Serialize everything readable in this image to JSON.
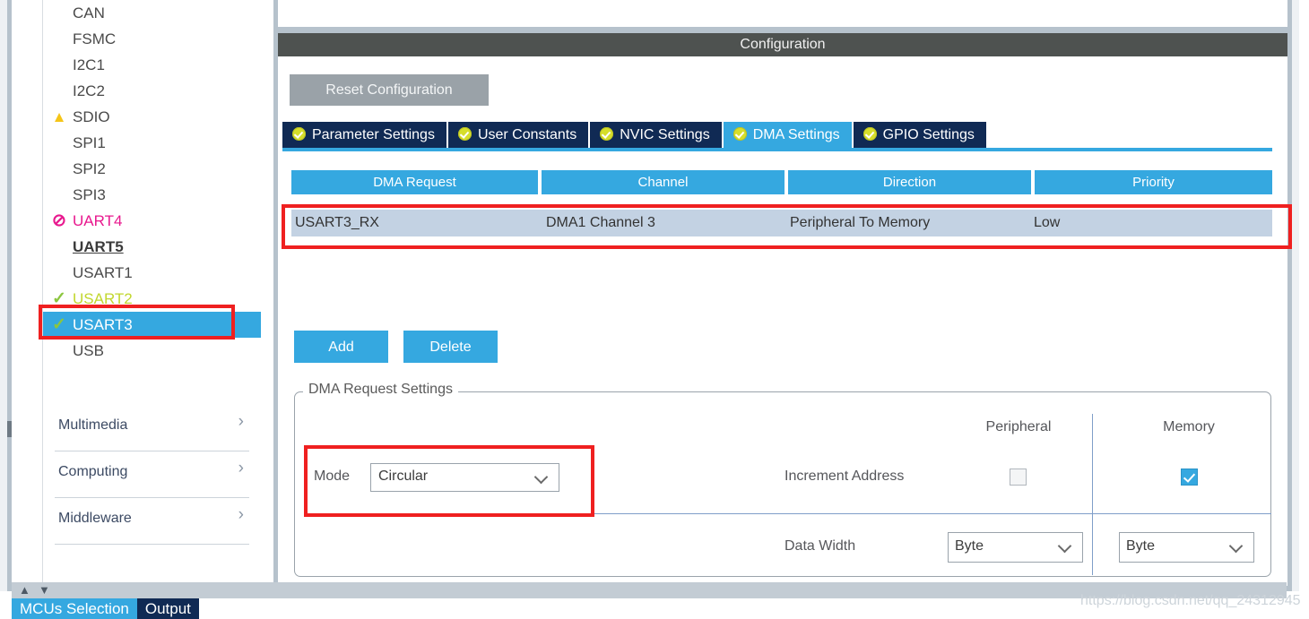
{
  "window": {
    "config_title": "Configuration",
    "watermark": "https://blog.csdn.net/qq_24312945"
  },
  "sidebar": {
    "peripherals": [
      {
        "label": "CAN",
        "icon": "none",
        "state": "normal"
      },
      {
        "label": "FSMC",
        "icon": "none",
        "state": "normal"
      },
      {
        "label": "I2C1",
        "icon": "none",
        "state": "normal"
      },
      {
        "label": "I2C2",
        "icon": "none",
        "state": "normal"
      },
      {
        "label": "SDIO",
        "icon": "warning-triangle-icon",
        "state": "warn",
        "glyph": "▲"
      },
      {
        "label": "SPI1",
        "icon": "none",
        "state": "normal"
      },
      {
        "label": "SPI2",
        "icon": "none",
        "state": "normal"
      },
      {
        "label": "SPI3",
        "icon": "none",
        "state": "normal"
      },
      {
        "label": "UART4",
        "icon": "blocked-icon",
        "state": "blocked",
        "glyph": "⊘"
      },
      {
        "label": "UART5",
        "icon": "none",
        "state": "bold"
      },
      {
        "label": "USART1",
        "icon": "none",
        "state": "normal"
      },
      {
        "label": "USART2",
        "icon": "check-icon",
        "state": "ok",
        "glyph": "✓"
      },
      {
        "label": "USART3",
        "icon": "check-icon",
        "state": "selected",
        "glyph": "✓"
      },
      {
        "label": "USB",
        "icon": "none",
        "state": "normal"
      }
    ],
    "categories": [
      {
        "label": "Multimedia",
        "arrow": "›"
      },
      {
        "label": "Computing",
        "arrow": "›"
      },
      {
        "label": "Middleware",
        "arrow": "›"
      }
    ]
  },
  "bottom_tabs": [
    {
      "label": "MCUs Selection",
      "active": true
    },
    {
      "label": "Output",
      "active": false
    }
  ],
  "toolbar": {
    "reset_label": "Reset Configuration"
  },
  "tabs": [
    {
      "label": "Parameter Settings",
      "active": false
    },
    {
      "label": "User Constants",
      "active": false
    },
    {
      "label": "NVIC Settings",
      "active": false
    },
    {
      "label": "DMA Settings",
      "active": true
    },
    {
      "label": "GPIO Settings",
      "active": false
    }
  ],
  "table": {
    "headers": [
      "DMA Request",
      "Channel",
      "Direction",
      "Priority"
    ],
    "rows": [
      {
        "dma_request": "USART3_RX",
        "channel": "DMA1 Channel 3",
        "direction": "Peripheral To Memory",
        "priority": "Low",
        "selected": true
      }
    ]
  },
  "actions": {
    "add_label": "Add",
    "delete_label": "Delete"
  },
  "settings": {
    "group_title": "DMA Request Settings",
    "col_peripheral": "Peripheral",
    "col_memory": "Memory",
    "mode_label": "Mode",
    "mode_value": "Circular",
    "increment_label": "Increment Address",
    "increment_peripheral_checked": false,
    "increment_memory_checked": true,
    "data_width_label": "Data Width",
    "data_width_peripheral": "Byte",
    "data_width_memory": "Byte"
  },
  "colors": {
    "accent_blue": "#35a8e0",
    "tab_navy": "#102a54",
    "title_gray": "#4e5250",
    "row_selected": "#c3d2e3",
    "annotation_red": "#ef2020"
  }
}
